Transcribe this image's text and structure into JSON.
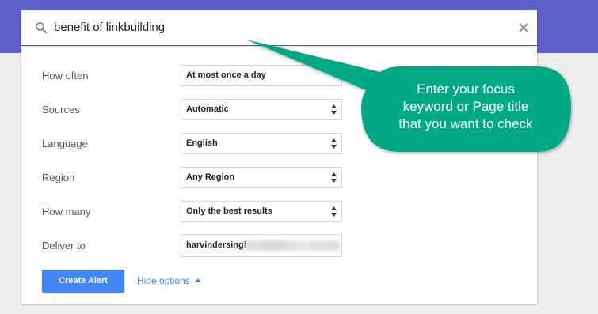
{
  "search": {
    "query": "benefit of linkbuilding"
  },
  "options": [
    {
      "label": "How often",
      "value": "At most once a day",
      "has_arrows": false
    },
    {
      "label": "Sources",
      "value": "Automatic",
      "has_arrows": true
    },
    {
      "label": "Language",
      "value": "English",
      "has_arrows": true
    },
    {
      "label": "Region",
      "value": "Any Region",
      "has_arrows": true
    },
    {
      "label": "How many",
      "value": "Only the best results",
      "has_arrows": true
    }
  ],
  "deliver": {
    "label": "Deliver to",
    "value": "harvindersingh"
  },
  "actions": {
    "create_label": "Create Alert",
    "hide_label": "Hide options"
  },
  "callout": {
    "lines": [
      "Enter your focus",
      "keyword or Page title",
      "that you want to check"
    ]
  },
  "colors": {
    "header": "#5b5fc7",
    "accent": "#4285f4",
    "callout": "#00a884"
  },
  "icons": {
    "search": "search-icon",
    "close": "close-icon",
    "select_arrows": "updown-arrows-icon",
    "caret": "caret-up-icon"
  }
}
